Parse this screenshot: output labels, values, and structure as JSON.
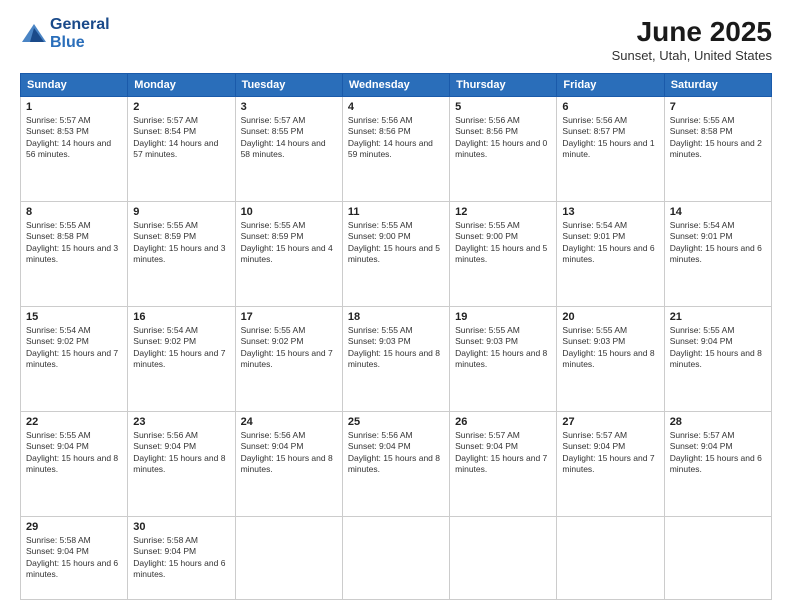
{
  "header": {
    "logo_line1": "General",
    "logo_line2": "Blue",
    "main_title": "June 2025",
    "sub_title": "Sunset, Utah, United States"
  },
  "days_of_week": [
    "Sunday",
    "Monday",
    "Tuesday",
    "Wednesday",
    "Thursday",
    "Friday",
    "Saturday"
  ],
  "weeks": [
    [
      {
        "day": "1",
        "sunrise": "Sunrise: 5:57 AM",
        "sunset": "Sunset: 8:53 PM",
        "daylight": "Daylight: 14 hours and 56 minutes."
      },
      {
        "day": "2",
        "sunrise": "Sunrise: 5:57 AM",
        "sunset": "Sunset: 8:54 PM",
        "daylight": "Daylight: 14 hours and 57 minutes."
      },
      {
        "day": "3",
        "sunrise": "Sunrise: 5:57 AM",
        "sunset": "Sunset: 8:55 PM",
        "daylight": "Daylight: 14 hours and 58 minutes."
      },
      {
        "day": "4",
        "sunrise": "Sunrise: 5:56 AM",
        "sunset": "Sunset: 8:56 PM",
        "daylight": "Daylight: 14 hours and 59 minutes."
      },
      {
        "day": "5",
        "sunrise": "Sunrise: 5:56 AM",
        "sunset": "Sunset: 8:56 PM",
        "daylight": "Daylight: 15 hours and 0 minutes."
      },
      {
        "day": "6",
        "sunrise": "Sunrise: 5:56 AM",
        "sunset": "Sunset: 8:57 PM",
        "daylight": "Daylight: 15 hours and 1 minute."
      },
      {
        "day": "7",
        "sunrise": "Sunrise: 5:55 AM",
        "sunset": "Sunset: 8:58 PM",
        "daylight": "Daylight: 15 hours and 2 minutes."
      }
    ],
    [
      {
        "day": "8",
        "sunrise": "Sunrise: 5:55 AM",
        "sunset": "Sunset: 8:58 PM",
        "daylight": "Daylight: 15 hours and 3 minutes."
      },
      {
        "day": "9",
        "sunrise": "Sunrise: 5:55 AM",
        "sunset": "Sunset: 8:59 PM",
        "daylight": "Daylight: 15 hours and 3 minutes."
      },
      {
        "day": "10",
        "sunrise": "Sunrise: 5:55 AM",
        "sunset": "Sunset: 8:59 PM",
        "daylight": "Daylight: 15 hours and 4 minutes."
      },
      {
        "day": "11",
        "sunrise": "Sunrise: 5:55 AM",
        "sunset": "Sunset: 9:00 PM",
        "daylight": "Daylight: 15 hours and 5 minutes."
      },
      {
        "day": "12",
        "sunrise": "Sunrise: 5:55 AM",
        "sunset": "Sunset: 9:00 PM",
        "daylight": "Daylight: 15 hours and 5 minutes."
      },
      {
        "day": "13",
        "sunrise": "Sunrise: 5:54 AM",
        "sunset": "Sunset: 9:01 PM",
        "daylight": "Daylight: 15 hours and 6 minutes."
      },
      {
        "day": "14",
        "sunrise": "Sunrise: 5:54 AM",
        "sunset": "Sunset: 9:01 PM",
        "daylight": "Daylight: 15 hours and 6 minutes."
      }
    ],
    [
      {
        "day": "15",
        "sunrise": "Sunrise: 5:54 AM",
        "sunset": "Sunset: 9:02 PM",
        "daylight": "Daylight: 15 hours and 7 minutes."
      },
      {
        "day": "16",
        "sunrise": "Sunrise: 5:54 AM",
        "sunset": "Sunset: 9:02 PM",
        "daylight": "Daylight: 15 hours and 7 minutes."
      },
      {
        "day": "17",
        "sunrise": "Sunrise: 5:55 AM",
        "sunset": "Sunset: 9:02 PM",
        "daylight": "Daylight: 15 hours and 7 minutes."
      },
      {
        "day": "18",
        "sunrise": "Sunrise: 5:55 AM",
        "sunset": "Sunset: 9:03 PM",
        "daylight": "Daylight: 15 hours and 8 minutes."
      },
      {
        "day": "19",
        "sunrise": "Sunrise: 5:55 AM",
        "sunset": "Sunset: 9:03 PM",
        "daylight": "Daylight: 15 hours and 8 minutes."
      },
      {
        "day": "20",
        "sunrise": "Sunrise: 5:55 AM",
        "sunset": "Sunset: 9:03 PM",
        "daylight": "Daylight: 15 hours and 8 minutes."
      },
      {
        "day": "21",
        "sunrise": "Sunrise: 5:55 AM",
        "sunset": "Sunset: 9:04 PM",
        "daylight": "Daylight: 15 hours and 8 minutes."
      }
    ],
    [
      {
        "day": "22",
        "sunrise": "Sunrise: 5:55 AM",
        "sunset": "Sunset: 9:04 PM",
        "daylight": "Daylight: 15 hours and 8 minutes."
      },
      {
        "day": "23",
        "sunrise": "Sunrise: 5:56 AM",
        "sunset": "Sunset: 9:04 PM",
        "daylight": "Daylight: 15 hours and 8 minutes."
      },
      {
        "day": "24",
        "sunrise": "Sunrise: 5:56 AM",
        "sunset": "Sunset: 9:04 PM",
        "daylight": "Daylight: 15 hours and 8 minutes."
      },
      {
        "day": "25",
        "sunrise": "Sunrise: 5:56 AM",
        "sunset": "Sunset: 9:04 PM",
        "daylight": "Daylight: 15 hours and 8 minutes."
      },
      {
        "day": "26",
        "sunrise": "Sunrise: 5:57 AM",
        "sunset": "Sunset: 9:04 PM",
        "daylight": "Daylight: 15 hours and 7 minutes."
      },
      {
        "day": "27",
        "sunrise": "Sunrise: 5:57 AM",
        "sunset": "Sunset: 9:04 PM",
        "daylight": "Daylight: 15 hours and 7 minutes."
      },
      {
        "day": "28",
        "sunrise": "Sunrise: 5:57 AM",
        "sunset": "Sunset: 9:04 PM",
        "daylight": "Daylight: 15 hours and 6 minutes."
      }
    ],
    [
      {
        "day": "29",
        "sunrise": "Sunrise: 5:58 AM",
        "sunset": "Sunset: 9:04 PM",
        "daylight": "Daylight: 15 hours and 6 minutes."
      },
      {
        "day": "30",
        "sunrise": "Sunrise: 5:58 AM",
        "sunset": "Sunset: 9:04 PM",
        "daylight": "Daylight: 15 hours and 6 minutes."
      },
      null,
      null,
      null,
      null,
      null
    ]
  ]
}
